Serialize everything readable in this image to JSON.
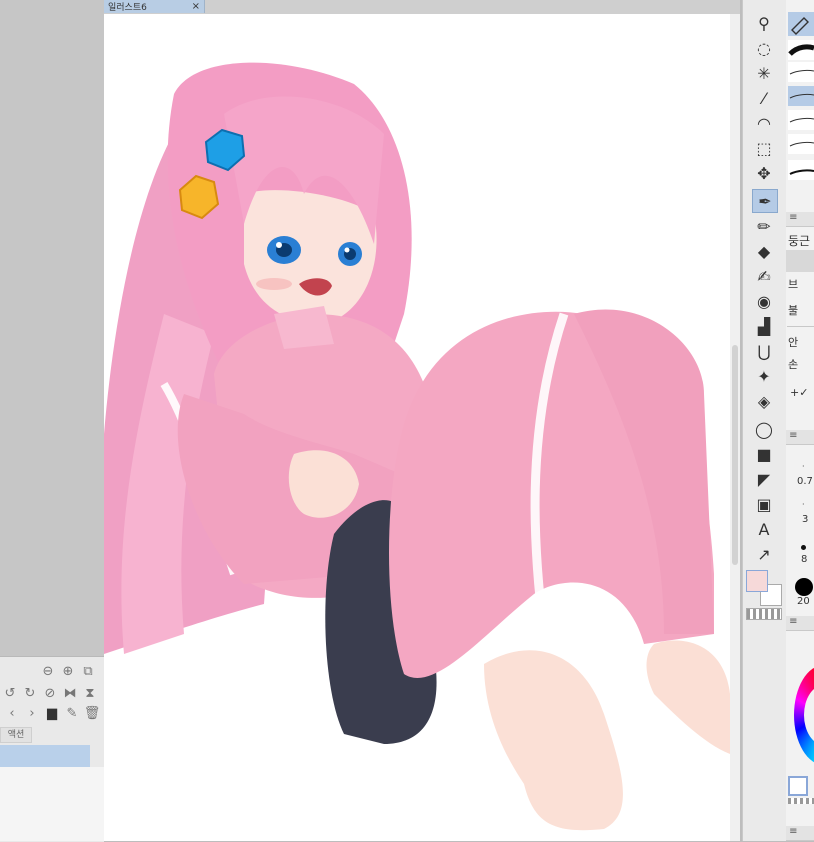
{
  "document": {
    "tab_title": "일러스트6",
    "close_glyph": "×"
  },
  "panel_left": {
    "action_tab": "액션"
  },
  "tool_property": {
    "brush_name": "둥근",
    "rows": [
      "브",
      "불",
      "안",
      "손"
    ],
    "checkbox_row": "+✓"
  },
  "brush_size": {
    "values": [
      "0.7",
      "3",
      "8",
      "20"
    ]
  },
  "colors": {
    "main_color": "#f6d9d9",
    "sub_color": "#ffffff",
    "accent": "#b5cbe6"
  }
}
